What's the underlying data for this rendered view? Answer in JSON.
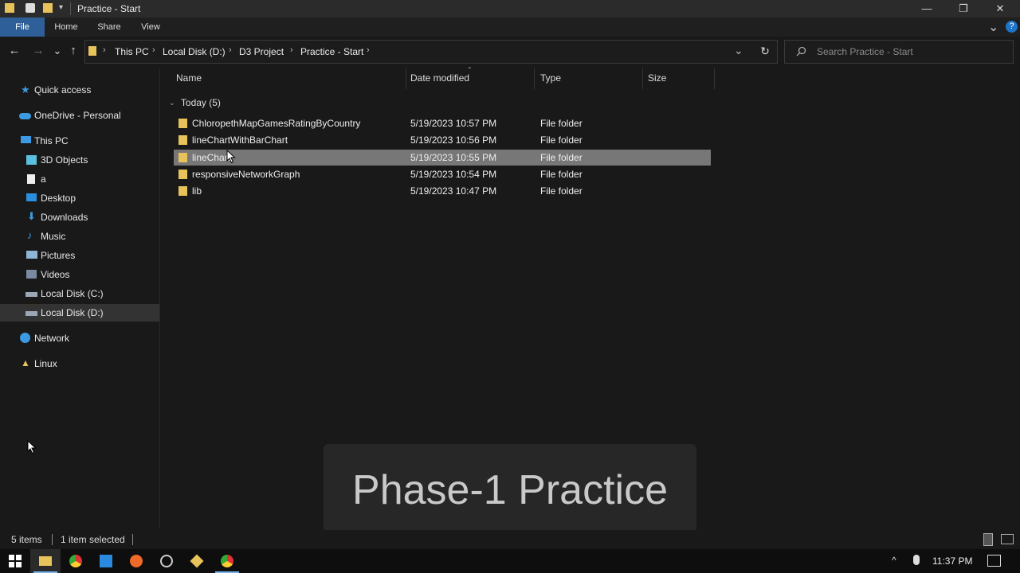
{
  "window": {
    "title": "Practice - Start",
    "min_glyph": "—",
    "restore_glyph": "❐",
    "close_glyph": "✕"
  },
  "ribbon": {
    "tabs": [
      "File",
      "Home",
      "Share",
      "View"
    ],
    "active_tab": "File",
    "expand_glyph": "⌄",
    "help_glyph": "?"
  },
  "nav": {
    "back_glyph": "←",
    "forward_glyph": "→",
    "recent_glyph": "⌄",
    "up_glyph": "↑",
    "refresh_glyph": "↻",
    "dropdown_glyph": "⌄"
  },
  "address": {
    "crumbs": [
      "This PC",
      "Local Disk (D:)",
      "D3 Project",
      "Practice - Start"
    ],
    "separator": "›"
  },
  "search": {
    "placeholder": "Search Practice - Start"
  },
  "sidebar": {
    "items": [
      {
        "label": "Quick access",
        "icon": "star-icon"
      },
      {
        "label": "OneDrive - Personal",
        "icon": "cloud-icon"
      },
      {
        "label": "This PC",
        "icon": "computer-icon"
      },
      {
        "label": "3D Objects",
        "icon": "cube-icon"
      },
      {
        "label": "a",
        "icon": "document-icon"
      },
      {
        "label": "Desktop",
        "icon": "desktop-icon"
      },
      {
        "label": "Downloads",
        "icon": "download-icon"
      },
      {
        "label": "Music",
        "icon": "music-icon"
      },
      {
        "label": "Pictures",
        "icon": "pictures-icon"
      },
      {
        "label": "Videos",
        "icon": "video-icon"
      },
      {
        "label": "Local Disk (C:)",
        "icon": "drive-icon"
      },
      {
        "label": "Local Disk (D:)",
        "icon": "drive-icon",
        "selected": true
      },
      {
        "label": "Network",
        "icon": "network-icon"
      },
      {
        "label": "Linux",
        "icon": "linux-icon"
      }
    ]
  },
  "columns": {
    "name": "Name",
    "date": "Date modified",
    "type": "Type",
    "size": "Size"
  },
  "group": {
    "label": "Today (5)"
  },
  "files": [
    {
      "name": "ChloropethMapGamesRatingByCountry",
      "date": "5/19/2023 10:57 PM",
      "type": "File folder"
    },
    {
      "name": "lineChartWithBarChart",
      "date": "5/19/2023 10:56 PM",
      "type": "File folder"
    },
    {
      "name": "lineChart",
      "date": "5/19/2023 10:55 PM",
      "type": "File folder",
      "selected": true
    },
    {
      "name": "responsiveNetworkGraph",
      "date": "5/19/2023 10:54 PM",
      "type": "File folder"
    },
    {
      "name": "lib",
      "date": "5/19/2023 10:47 PM",
      "type": "File folder"
    }
  ],
  "status": {
    "count": "5 items",
    "selected": "1 item selected"
  },
  "overlay": {
    "caption": "Phase-1 Practice"
  },
  "taskbar": {
    "time": "11:37 PM",
    "apps": [
      "windows-start-icon",
      "file-explorer-icon",
      "chrome-icon",
      "vscode-icon",
      "firefox-icon",
      "app-icon",
      "git-icon",
      "chrome-icon"
    ],
    "tray_chevron": "^"
  },
  "colors": {
    "accent": "#2f5f99",
    "folder": "#e8c25a",
    "selection": "#777777"
  }
}
